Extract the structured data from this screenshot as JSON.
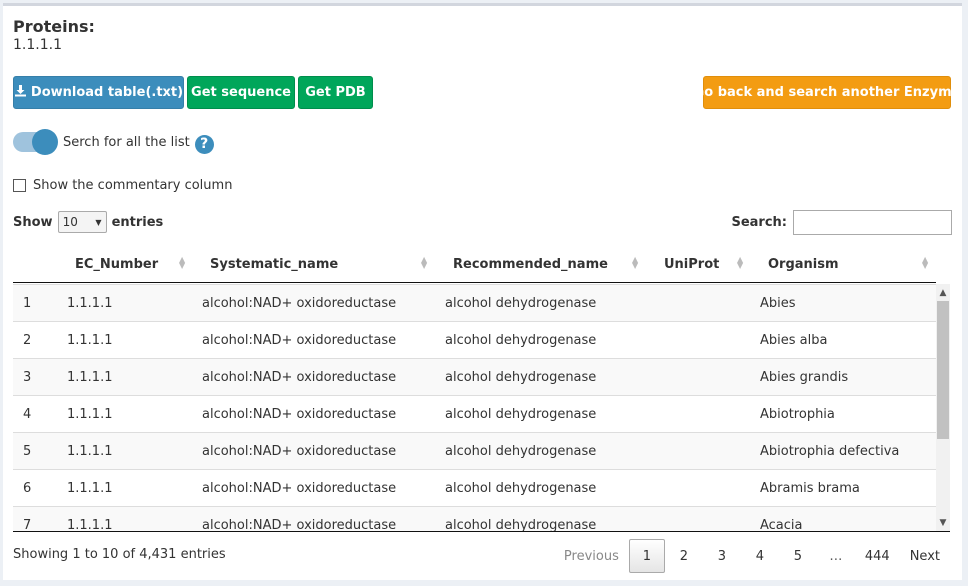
{
  "header": {
    "title": "Proteins:",
    "subtitle": "1.1.1.1"
  },
  "buttons": {
    "download": "Download table(.txt)",
    "sequence": "Get sequence",
    "pdb": "Get PDB",
    "back": "Go back and search another Enzyme"
  },
  "toggle": {
    "label": "Serch for all the list",
    "on": true,
    "help": "?"
  },
  "commentary": {
    "label": "Show the commentary column",
    "checked": false
  },
  "length": {
    "show": "Show",
    "value": "10",
    "entries": "entries"
  },
  "search": {
    "label": "Search:",
    "value": ""
  },
  "columns": [
    "EC_Number",
    "Systematic_name",
    "Recommended_name",
    "UniProt",
    "Organism"
  ],
  "rows": [
    {
      "idx": "1",
      "ec": "1.1.1.1",
      "sys": "alcohol:NAD+ oxidoreductase",
      "rec": "alcohol dehydrogenase",
      "uniprot": "",
      "org": "Abies"
    },
    {
      "idx": "2",
      "ec": "1.1.1.1",
      "sys": "alcohol:NAD+ oxidoreductase",
      "rec": "alcohol dehydrogenase",
      "uniprot": "",
      "org": "Abies alba"
    },
    {
      "idx": "3",
      "ec": "1.1.1.1",
      "sys": "alcohol:NAD+ oxidoreductase",
      "rec": "alcohol dehydrogenase",
      "uniprot": "",
      "org": "Abies grandis"
    },
    {
      "idx": "4",
      "ec": "1.1.1.1",
      "sys": "alcohol:NAD+ oxidoreductase",
      "rec": "alcohol dehydrogenase",
      "uniprot": "",
      "org": "Abiotrophia"
    },
    {
      "idx": "5",
      "ec": "1.1.1.1",
      "sys": "alcohol:NAD+ oxidoreductase",
      "rec": "alcohol dehydrogenase",
      "uniprot": "",
      "org": "Abiotrophia defectiva"
    },
    {
      "idx": "6",
      "ec": "1.1.1.1",
      "sys": "alcohol:NAD+ oxidoreductase",
      "rec": "alcohol dehydrogenase",
      "uniprot": "",
      "org": "Abramis brama"
    },
    {
      "idx": "7",
      "ec": "1.1.1.1",
      "sys": "alcohol:NAD+ oxidoreductase",
      "rec": "alcohol dehydrogenase",
      "uniprot": "",
      "org": "Acacia"
    }
  ],
  "info": "Showing 1 to 10 of 4,431 entries",
  "pagination": {
    "previous": "Previous",
    "pages": [
      "1",
      "2",
      "3",
      "4",
      "5"
    ],
    "current": "1",
    "ellipsis": "…",
    "last": "444",
    "next": "Next"
  },
  "colors": {
    "primary": "#3c8dbc",
    "success": "#00a65a",
    "warning": "#f39c12"
  }
}
